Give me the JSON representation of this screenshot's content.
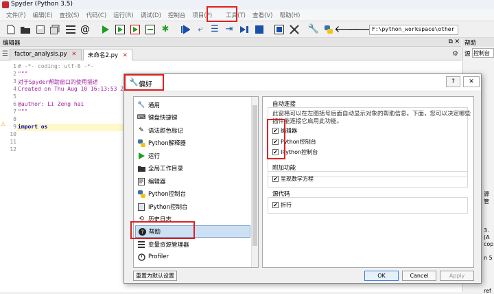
{
  "window": {
    "title": "Spyder (Python 3.5)"
  },
  "menubar": {
    "items": [
      "文件(F)",
      "编辑(E)",
      "查找(S)",
      "代码(C)",
      "运行(R)",
      "调试(D)",
      "控制台",
      "项目(P)",
      "工具(T)",
      "查看(V)",
      "帮助(H)"
    ]
  },
  "toolbar": {
    "path_value": "F:\\python_workspace\\other"
  },
  "editor": {
    "pane_title": "编辑器",
    "tabs": [
      "factor_analysis.py",
      "未命名2.py"
    ],
    "line_numbers": [
      "1",
      "2",
      "3",
      "4",
      "5",
      "6",
      "7",
      "8",
      "9",
      "10",
      "11",
      "12"
    ],
    "lines": [
      "# -*- coding: utf-8 -*-",
      "\"\"\"",
      "对于Spyder帮助窗口的使用描述",
      "Created on Thu Aug 10 16:13:53 2",
      "",
      "@author: Li Zeng hai",
      "\"\"\"",
      "",
      "import os",
      "",
      "",
      ""
    ]
  },
  "help_pane": {
    "title": "帮助",
    "source_label": "源",
    "console_label": "控制台"
  },
  "dialog": {
    "title": "偏好",
    "categories": [
      {
        "label": "通用",
        "icon": "wrench-icon"
      },
      {
        "label": "键盘快捷键",
        "icon": "keyboard-icon"
      },
      {
        "label": "语法颜色标记",
        "icon": "pen-icon"
      },
      {
        "label": "Python解释器",
        "icon": "python-icon"
      },
      {
        "label": "运行",
        "icon": "play-icon"
      },
      {
        "label": "全局工作目录",
        "icon": "folder-icon"
      },
      {
        "label": "编辑器",
        "icon": "editor-icon"
      },
      {
        "label": "Python控制台",
        "icon": "python-icon"
      },
      {
        "label": "IPython控制台",
        "icon": "ipython-icon"
      },
      {
        "label": "历史日志",
        "icon": "history-icon"
      },
      {
        "label": "帮助",
        "icon": "question-icon"
      },
      {
        "label": "变量资源管理器",
        "icon": "table-icon"
      },
      {
        "label": "Profiler",
        "icon": "profiler-icon"
      }
    ],
    "selected_category": "帮助",
    "auto_connect": {
      "heading": "自动连接",
      "description_line1": "此窗格可以在左图括号后面自动显示对象的帮助信息。下面，您可以决定哪些",
      "description_line2": "插件能连接它启用此功能。",
      "options": [
        {
          "label": "编辑器",
          "checked": true
        },
        {
          "label": "Python控制台",
          "checked": true
        },
        {
          "label": "IPython控制台",
          "checked": true
        }
      ]
    },
    "additional": {
      "heading": "附加功能",
      "options": [
        {
          "label": "呈现数学方程",
          "checked": true
        }
      ]
    },
    "source_code": {
      "heading": "源代码",
      "options": [
        {
          "label": "折行",
          "checked": true
        }
      ]
    },
    "buttons": {
      "reset": "重置为默认设置",
      "ok": "OK",
      "cancel": "Cancel",
      "apply": "Apply"
    }
  },
  "right_snippets": [
    "源管",
    "3.",
    "(A",
    "cop",
    "n 5",
    "ref"
  ],
  "colors": {
    "highlight": "#e02020",
    "selection": "#cde0f3",
    "comment": "#8a8a8a",
    "string": "#a0229e",
    "keyword": "#0000b0"
  }
}
